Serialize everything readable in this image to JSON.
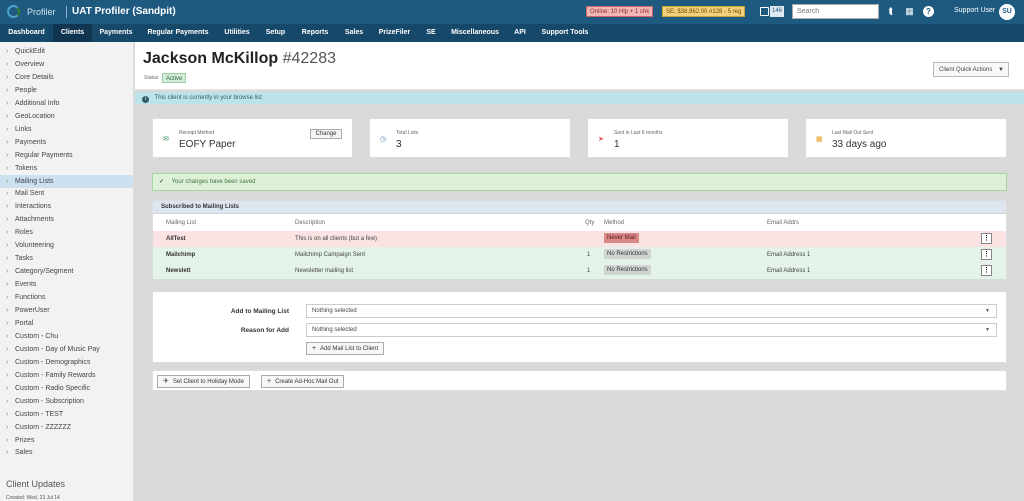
{
  "topbar": {
    "brand": "Profiler",
    "app_title": "UAT Profiler (Sandpit)",
    "online_badge": "Online: 10 Hlp + 1 chk",
    "se_badge": "SE: $38,962.00 #128 - 5 reg",
    "count": "146",
    "search_placeholder": "Search",
    "help_glyph": "?",
    "user_name": "Support User",
    "user_initials": "SU"
  },
  "nav": [
    "Dashboard",
    "Clients",
    "Payments",
    "Regular Payments",
    "Utilities",
    "Setup",
    "Reports",
    "Sales",
    "PrizeFiler",
    "SE",
    "Miscellaneous",
    "API",
    "Support Tools"
  ],
  "sidebar": {
    "items": [
      "QuickEdit",
      "Overview",
      "Core Details",
      "People",
      "Additional Info",
      "GeoLocation",
      "Links",
      "Payments",
      "Regular Payments",
      "Tokens",
      "Mailing Lists",
      "Mail Sent",
      "Interactions",
      "Attachments",
      "Roles",
      "Volunteering",
      "Tasks",
      "Category/Segment",
      "Events",
      "Functions",
      "PowerUser",
      "Portal",
      "Custom - Chu",
      "Custom - Day of Music Pay",
      "Custom - Demographics",
      "Custom - Family Rewards",
      "Custom - Radio Specific",
      "Custom - Subscription",
      "Custom - TEST",
      "Custom - ZZZZZZ",
      "Prizes",
      "Sales"
    ],
    "active": "Mailing Lists",
    "footer_heading": "Client Updates",
    "footer_created": "Created: Wed, 23 Jul 14"
  },
  "client": {
    "name": "Jackson McKillop",
    "id": "#42283",
    "status_label": "Status",
    "status": "Active",
    "quick_actions": "Client Quick Actions"
  },
  "browse_info": "This client is currently in your browse list",
  "cards": [
    {
      "label": "Receipt Method",
      "value": "EOFY Paper",
      "icon": "envelope-icon",
      "action": "Change"
    },
    {
      "label": "Total Lists",
      "value": "3",
      "icon": "clock-icon"
    },
    {
      "label": "Sent in Last 6 months",
      "value": "1",
      "icon": "send-icon"
    },
    {
      "label": "Last Mail Out Sent",
      "value": "33 days ago",
      "icon": "calendar-icon"
    }
  ],
  "success_message": "Your changes have been saved",
  "mailing_lists": {
    "title": "Subscribed to Mailing Lists",
    "columns": {
      "list": "Mailing List",
      "description": "Description",
      "qty": "Qty",
      "method": "Method",
      "email": "Email Addrs"
    },
    "rows": [
      {
        "list": "AllTest",
        "description": "This is on all clients (but a few)",
        "qty": "",
        "method": "Never Mail",
        "email": "",
        "status": "never"
      },
      {
        "list": "Mailchimp",
        "description": "Mailchimp Campaign Sent",
        "qty": "1",
        "method": "No Restrictions",
        "email": "Email Address 1",
        "status": "ok"
      },
      {
        "list": "Newslett",
        "description": "Newsletter mailing list",
        "qty": "1",
        "method": "No Restrictions",
        "email": "Email Address 1",
        "status": "ok"
      }
    ]
  },
  "add_form": {
    "list_label": "Add to Mailing List",
    "list_value": "Nothing selected",
    "reason_label": "Reason for Add",
    "reason_value": "Nothing selected",
    "add_button": "Add Mail List to Client"
  },
  "actions": {
    "holiday": "Set Client to Holiday Mode",
    "adhoc": "Create Ad-Hoc Mail Out"
  },
  "colors": {
    "topbar": "#1e5a80",
    "navbar": "#16486a",
    "success_bg": "#dff0d8",
    "never_mail": "#d98888"
  }
}
